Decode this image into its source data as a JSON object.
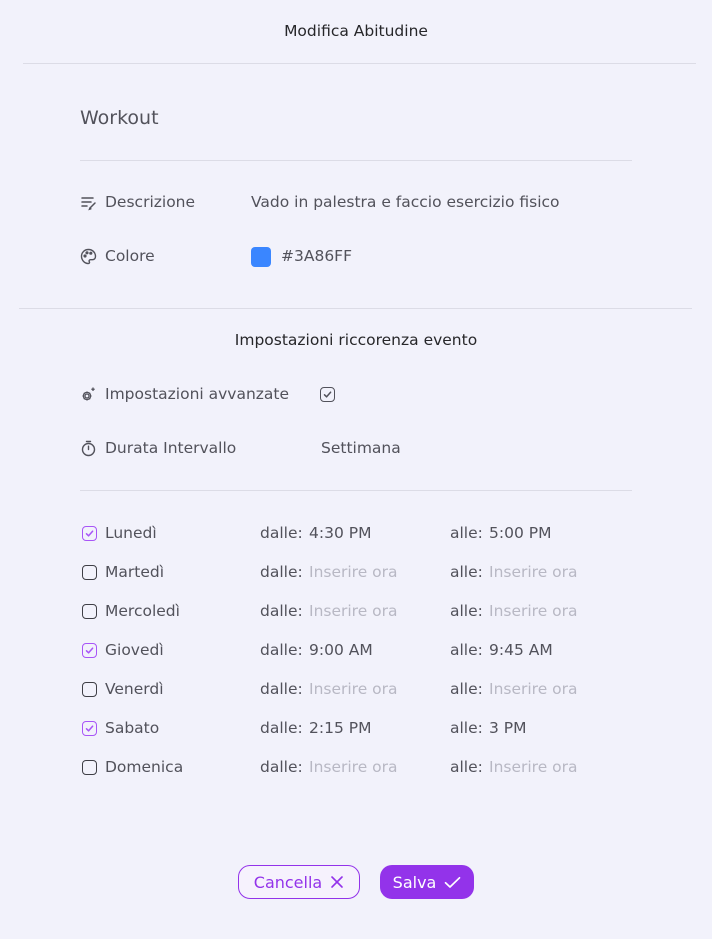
{
  "header": {
    "title": "Modifica Abitudine"
  },
  "habit": {
    "name": "Workout",
    "description_label": "Descrizione",
    "description_value": "Vado in palestra e faccio esercizio fisico",
    "color_label": "Colore",
    "color_value": "#3A86FF"
  },
  "recurrence": {
    "title": "Impostazioni riccorenza evento",
    "advanced_label": "Impostazioni avvanzate",
    "advanced_checked": true,
    "interval_label": "Durata Intervallo",
    "interval_value": "Settimana"
  },
  "days": [
    {
      "name": "Lunedì",
      "checked": true,
      "from_label": "dalle:",
      "from": "4:30 PM",
      "to_label": "alle:",
      "to": "5:00 PM"
    },
    {
      "name": "Martedì",
      "checked": false,
      "from_label": "dalle:",
      "from": "",
      "to_label": "alle:",
      "to": ""
    },
    {
      "name": "Mercoledì",
      "checked": false,
      "from_label": "dalle:",
      "from": "",
      "to_label": "alle:",
      "to": ""
    },
    {
      "name": "Giovedì",
      "checked": true,
      "from_label": "dalle:",
      "from": "9:00 AM",
      "to_label": "alle:",
      "to": "9:45 AM"
    },
    {
      "name": "Venerdì",
      "checked": false,
      "from_label": "dalle:",
      "from": "",
      "to_label": "alle:",
      "to": ""
    },
    {
      "name": "Sabato",
      "checked": true,
      "from_label": "dalle:",
      "from": "2:15 PM",
      "to_label": "alle:",
      "to": "3 PM"
    },
    {
      "name": "Domenica",
      "checked": false,
      "from_label": "dalle:",
      "from": "",
      "to_label": "alle:",
      "to": ""
    }
  ],
  "time_placeholder": "Inserire ora",
  "actions": {
    "cancel_label": "Cancella",
    "save_label": "Salva"
  },
  "colors": {
    "accent": "#9333EA",
    "check_accent": "#A855F7",
    "background": "#F2F2FB"
  },
  "icons": {
    "description": "text-edit-icon",
    "color": "palette-icon",
    "advanced": "gear-sparkle-icon",
    "interval": "stopwatch-icon",
    "cancel": "close-icon",
    "save": "check-icon"
  }
}
